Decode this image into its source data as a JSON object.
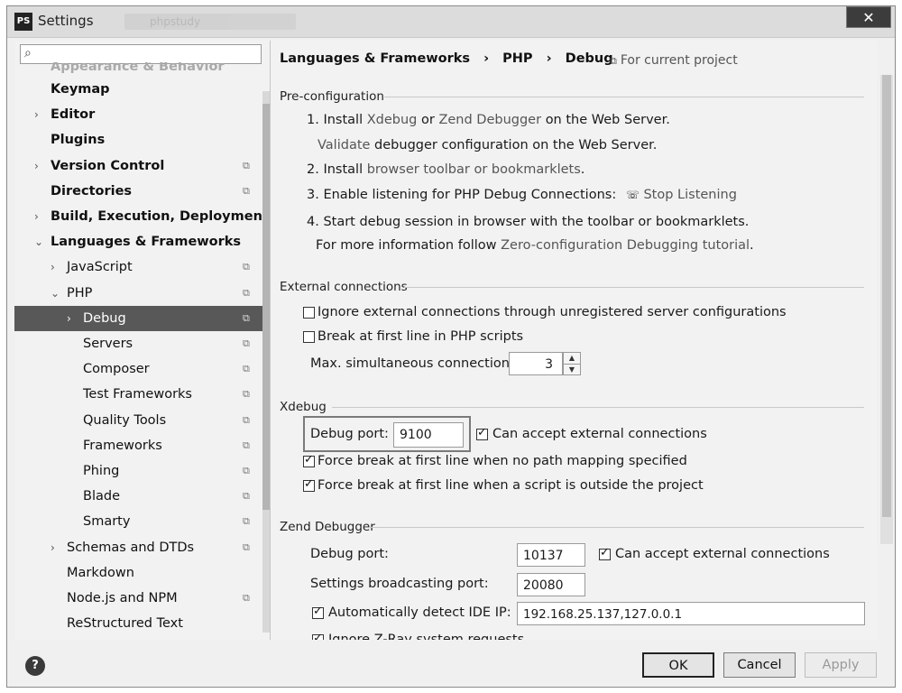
{
  "window": {
    "title": "Settings",
    "ghost_title": "phpstudy"
  },
  "search": {
    "placeholder": ""
  },
  "sidebar": {
    "items": [
      {
        "label": "Appearance & Behavior",
        "level": 0,
        "arrow": "",
        "bold": true,
        "proj": false,
        "cut": true
      },
      {
        "label": "Keymap",
        "level": 0,
        "arrow": "",
        "bold": true,
        "proj": false
      },
      {
        "label": "Editor",
        "level": 0,
        "arrow": "›",
        "bold": true,
        "proj": false
      },
      {
        "label": "Plugins",
        "level": 0,
        "arrow": "",
        "bold": true,
        "proj": false
      },
      {
        "label": "Version Control",
        "level": 0,
        "arrow": "›",
        "bold": true,
        "proj": true
      },
      {
        "label": "Directories",
        "level": 0,
        "arrow": "",
        "bold": true,
        "proj": true
      },
      {
        "label": "Build, Execution, Deployment",
        "level": 0,
        "arrow": "›",
        "bold": true,
        "proj": false
      },
      {
        "label": "Languages & Frameworks",
        "level": 0,
        "arrow": "⌄",
        "bold": true,
        "proj": false
      },
      {
        "label": "JavaScript",
        "level": 1,
        "arrow": "›",
        "bold": false,
        "proj": true
      },
      {
        "label": "PHP",
        "level": 1,
        "arrow": "⌄",
        "bold": false,
        "proj": true
      },
      {
        "label": "Debug",
        "level": 2,
        "arrow": "›",
        "bold": false,
        "proj": true,
        "selected": true
      },
      {
        "label": "Servers",
        "level": 2,
        "arrow": "",
        "bold": false,
        "proj": true
      },
      {
        "label": "Composer",
        "level": 2,
        "arrow": "",
        "bold": false,
        "proj": true
      },
      {
        "label": "Test Frameworks",
        "level": 2,
        "arrow": "",
        "bold": false,
        "proj": true
      },
      {
        "label": "Quality Tools",
        "level": 2,
        "arrow": "",
        "bold": false,
        "proj": true
      },
      {
        "label": "Frameworks",
        "level": 2,
        "arrow": "",
        "bold": false,
        "proj": true
      },
      {
        "label": "Phing",
        "level": 2,
        "arrow": "",
        "bold": false,
        "proj": true
      },
      {
        "label": "Blade",
        "level": 2,
        "arrow": "",
        "bold": false,
        "proj": true
      },
      {
        "label": "Smarty",
        "level": 2,
        "arrow": "",
        "bold": false,
        "proj": true
      },
      {
        "label": "Schemas and DTDs",
        "level": 1,
        "arrow": "›",
        "bold": false,
        "proj": true
      },
      {
        "label": "Markdown",
        "level": 1,
        "arrow": "",
        "bold": false,
        "proj": false
      },
      {
        "label": "Node.js and NPM",
        "level": 1,
        "arrow": "",
        "bold": false,
        "proj": true
      },
      {
        "label": "ReStructured Text",
        "level": 1,
        "arrow": "",
        "bold": false,
        "proj": false
      }
    ]
  },
  "breadcrumb": {
    "a": "Languages & Frameworks",
    "sep": "›",
    "b": "PHP",
    "c": "Debug"
  },
  "for_project": "For current project",
  "preconfig": {
    "title": "Pre-configuration",
    "s1_prefix": "1. Install",
    "s1_link1": "Xdebug",
    "s1_or": "or",
    "s1_link2": "Zend Debugger",
    "s1_suffix": "on the Web Server.",
    "s1b_link": "Validate",
    "s1b_suffix": "debugger configuration on the Web Server.",
    "s2_prefix": "2. Install",
    "s2_link": "browser toolbar or bookmarklets",
    "s2_suffix": ".",
    "s3": "3. Enable listening for PHP Debug Connections:",
    "s3_link": "Stop Listening",
    "s4": "4. Start debug session in browser with the toolbar or bookmarklets.",
    "s4b_prefix": "For more information follow",
    "s4b_link": "Zero-configuration Debugging tutorial",
    "s4b_suffix": "."
  },
  "external": {
    "title": "External connections",
    "ignore_label": "Ignore external connections through unregistered server configurations",
    "break_label": "Break at first line in PHP scripts",
    "max_label": "Max. simultaneous connections:",
    "max_value": "3"
  },
  "xdebug": {
    "title": "Xdebug",
    "port_label": "Debug port:",
    "port_value": "9100",
    "accept_label": "Can accept external connections",
    "force1_label": "Force break at first line when no path mapping specified",
    "force2_label": "Force break at first line when a script is outside the project"
  },
  "zend": {
    "title": "Zend Debugger",
    "port_label": "Debug port:",
    "port_value": "10137",
    "accept_label": "Can accept external connections",
    "broadcast_label": "Settings broadcasting port:",
    "broadcast_value": "20080",
    "auto_ip_label": "Automatically detect IDE IP:",
    "auto_ip_value": "192.168.25.137,127.0.0.1",
    "zray_label": "Ignore Z-Ray system requests"
  },
  "buttons": {
    "help": "?",
    "ok": "OK",
    "cancel": "Cancel",
    "apply": "Apply"
  },
  "colors": {
    "selected_bg": "#585858",
    "link": "#555555"
  }
}
